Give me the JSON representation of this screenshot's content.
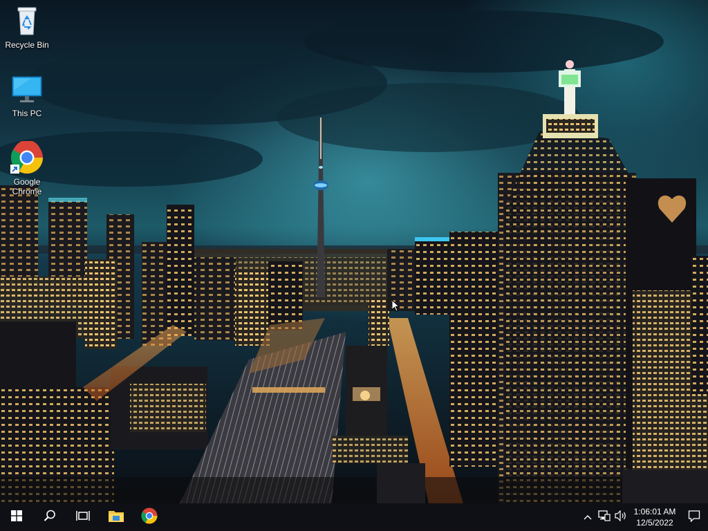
{
  "desktop": {
    "icons": [
      {
        "label": "Recycle Bin",
        "icon": "recycle-bin-icon"
      },
      {
        "label": "This PC",
        "icon": "monitor-icon"
      },
      {
        "label": "Google Chrome",
        "icon": "chrome-icon"
      }
    ]
  },
  "taskbar": {
    "buttons": [
      {
        "icon": "windows-start-icon"
      },
      {
        "icon": "search-icon"
      },
      {
        "icon": "task-view-icon"
      },
      {
        "icon": "file-explorer-icon"
      },
      {
        "icon": "chrome-icon"
      }
    ],
    "tray_icons": [
      "chevron-up-icon",
      "network-icon",
      "volume-icon"
    ],
    "clock": {
      "time": "1:06:01 AM",
      "date": "12/5/2022"
    },
    "notifications_icon": "action-center-icon"
  },
  "colors": {
    "taskbar_bg": "#101014",
    "active_indicator": "#7fb8e6",
    "sky_top": "#0a1a26",
    "sky_glow": "#2a7a8c"
  }
}
